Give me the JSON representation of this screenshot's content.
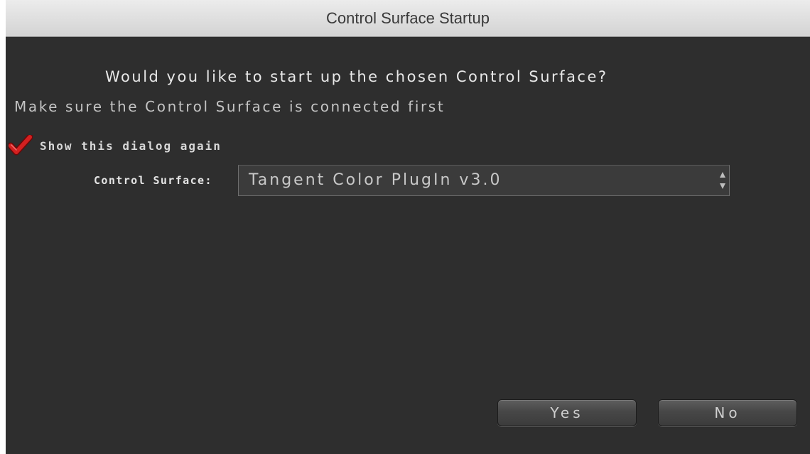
{
  "window": {
    "title": "Control Surface Startup"
  },
  "dialog": {
    "question": "Would you like to start up the chosen Control Surface?",
    "note": "Make sure the Control Surface is connected first",
    "show_again": {
      "label": "Show this dialog again",
      "checked": true,
      "icon": "checkmark-icon",
      "color": "#d42020"
    },
    "control_surface": {
      "label": "Control Surface:",
      "value": "Tangent Color PlugIn v3.0",
      "icon": "up-down-arrows-icon"
    },
    "buttons": {
      "yes": "Yes",
      "no": "No"
    }
  },
  "colors": {
    "background": "#2e2e2e",
    "titlebar": "#dcdcdc",
    "text": "#e8e8e8",
    "check": "#d42020"
  }
}
